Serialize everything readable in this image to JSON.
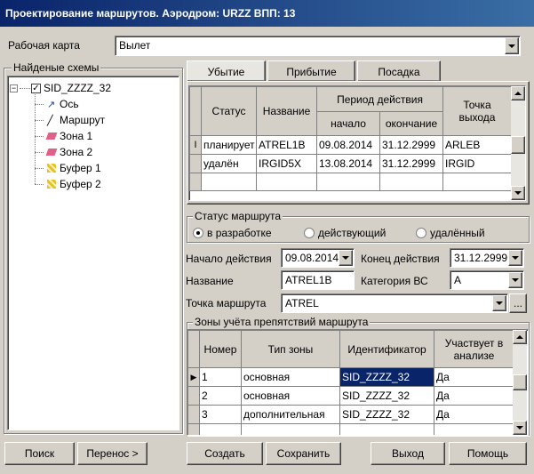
{
  "window": {
    "title": "Проектирование маршрутов. Аэродром: URZZ  ВПП: 13"
  },
  "work_map": {
    "label": "Рабочая карта",
    "value": "Вылет"
  },
  "found_schemes": {
    "label": "Найденые схемы",
    "root": "SID_ZZZZ_32",
    "children": [
      {
        "label": "Ось",
        "icon": "axis-icon"
      },
      {
        "label": "Маршрут",
        "icon": "route-icon"
      },
      {
        "label": "Зона 1",
        "icon": "zone-icon"
      },
      {
        "label": "Зона 2",
        "icon": "zone-icon"
      },
      {
        "label": "Буфер 1",
        "icon": "buffer-icon"
      },
      {
        "label": "Буфер 2",
        "icon": "buffer-icon"
      }
    ]
  },
  "tabs": [
    "Убытие",
    "Прибытие",
    "Посадка"
  ],
  "routes_table": {
    "headers": {
      "status": "Статус",
      "name": "Название",
      "period": "Период действия",
      "start": "начало",
      "end": "окончание",
      "exit_point": "Точка выхода"
    },
    "rows": [
      {
        "status": "планирует",
        "name": "ATREL1B",
        "start": "09.08.2014",
        "end": "31.12.2999",
        "exit": "ARLEB"
      },
      {
        "status": "удалён",
        "name": "IRGID5X",
        "start": "13.08.2014",
        "end": "31.12.2999",
        "exit": "IRGID"
      }
    ]
  },
  "route_status": {
    "label": "Статус маршрута",
    "options": [
      "в разработке",
      "действующий",
      "удалённый"
    ],
    "selected": "в разработке"
  },
  "form": {
    "start_label": "Начало действия",
    "start_value": "09.08.2014",
    "end_label": "Конец действия",
    "end_value": "31.12.2999",
    "name_label": "Название",
    "name_value": "ATREL1B",
    "category_label": "Категория ВС",
    "category_value": "A",
    "point_label": "Точка маршрута",
    "point_value": "ATREL",
    "ellipsis": "..."
  },
  "zones": {
    "label": "Зоны учёта препятствий маршрута",
    "headers": {
      "number": "Номер",
      "type": "Тип зоны",
      "id": "Идентификатор",
      "participates": "Участвует в анализе"
    },
    "rows": [
      {
        "number": "1",
        "type": "основная",
        "id": "SID_ZZZZ_32",
        "participates": "Да"
      },
      {
        "number": "2",
        "type": "основная",
        "id": "SID_ZZZZ_32",
        "participates": "Да"
      },
      {
        "number": "3",
        "type": "дополнительная",
        "id": "SID_ZZZZ_32",
        "participates": "Да"
      }
    ]
  },
  "buttons": {
    "search": "Поиск",
    "transfer": "Перенос >",
    "create": "Создать",
    "save": "Сохранить",
    "exit": "Выход",
    "help": "Помощь"
  }
}
